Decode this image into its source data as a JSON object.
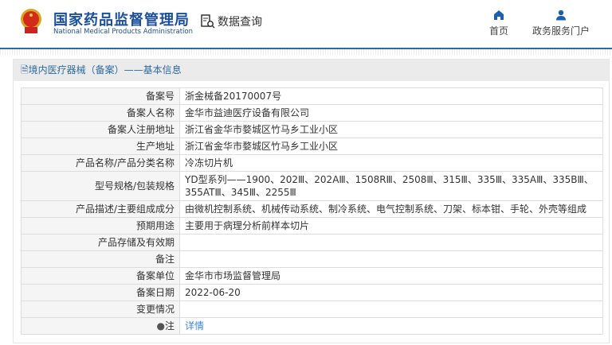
{
  "header": {
    "logo_cn": "国家药品监督管理局",
    "logo_en": "National Medical Products Administration",
    "query_label": "数据查询",
    "nav": [
      {
        "label": "首页",
        "icon": "home-icon"
      },
      {
        "label": "政务服务门户",
        "icon": "user-icon"
      }
    ]
  },
  "panel": {
    "title": "境内医疗器械（备案）——基本信息"
  },
  "rows": [
    {
      "label": "备案号",
      "value": "浙金械备20170007号"
    },
    {
      "label": "备案人名称",
      "value": "金华市益迪医疗设备有限公司"
    },
    {
      "label": "备案人注册地址",
      "value": "浙江省金华市婺城区竹马乡工业小区"
    },
    {
      "label": "生产地址",
      "value": "浙江省金华市婺城区竹马乡工业小区"
    },
    {
      "label": "产品名称/产品分类名称",
      "value": "冷冻切片机"
    },
    {
      "label": "型号规格/包装规格",
      "value": "YD型系列——1900、202Ⅲ、202AⅢ、1508RⅢ、2508Ⅲ、315Ⅲ、335Ⅲ、335AⅢ、335BⅢ、355ATⅢ、345Ⅲ、2255Ⅲ"
    },
    {
      "label": "产品描述/主要组成成分",
      "value": "由微机控制系统、机械传动系统、制冷系统、电气控制系统、刀架、标本钳、手轮、外壳等组成"
    },
    {
      "label": "预期用途",
      "value": "主要用于病理分析前样本切片"
    },
    {
      "label": "产品存储及有效期",
      "value": ""
    },
    {
      "label": "备注",
      "value": ""
    },
    {
      "label": "备案单位",
      "value": "金华市市场监督管理局"
    },
    {
      "label": "备案日期",
      "value": "2022-06-20"
    },
    {
      "label": "变更情况",
      "value": ""
    },
    {
      "label": "注",
      "value": "详情"
    }
  ]
}
